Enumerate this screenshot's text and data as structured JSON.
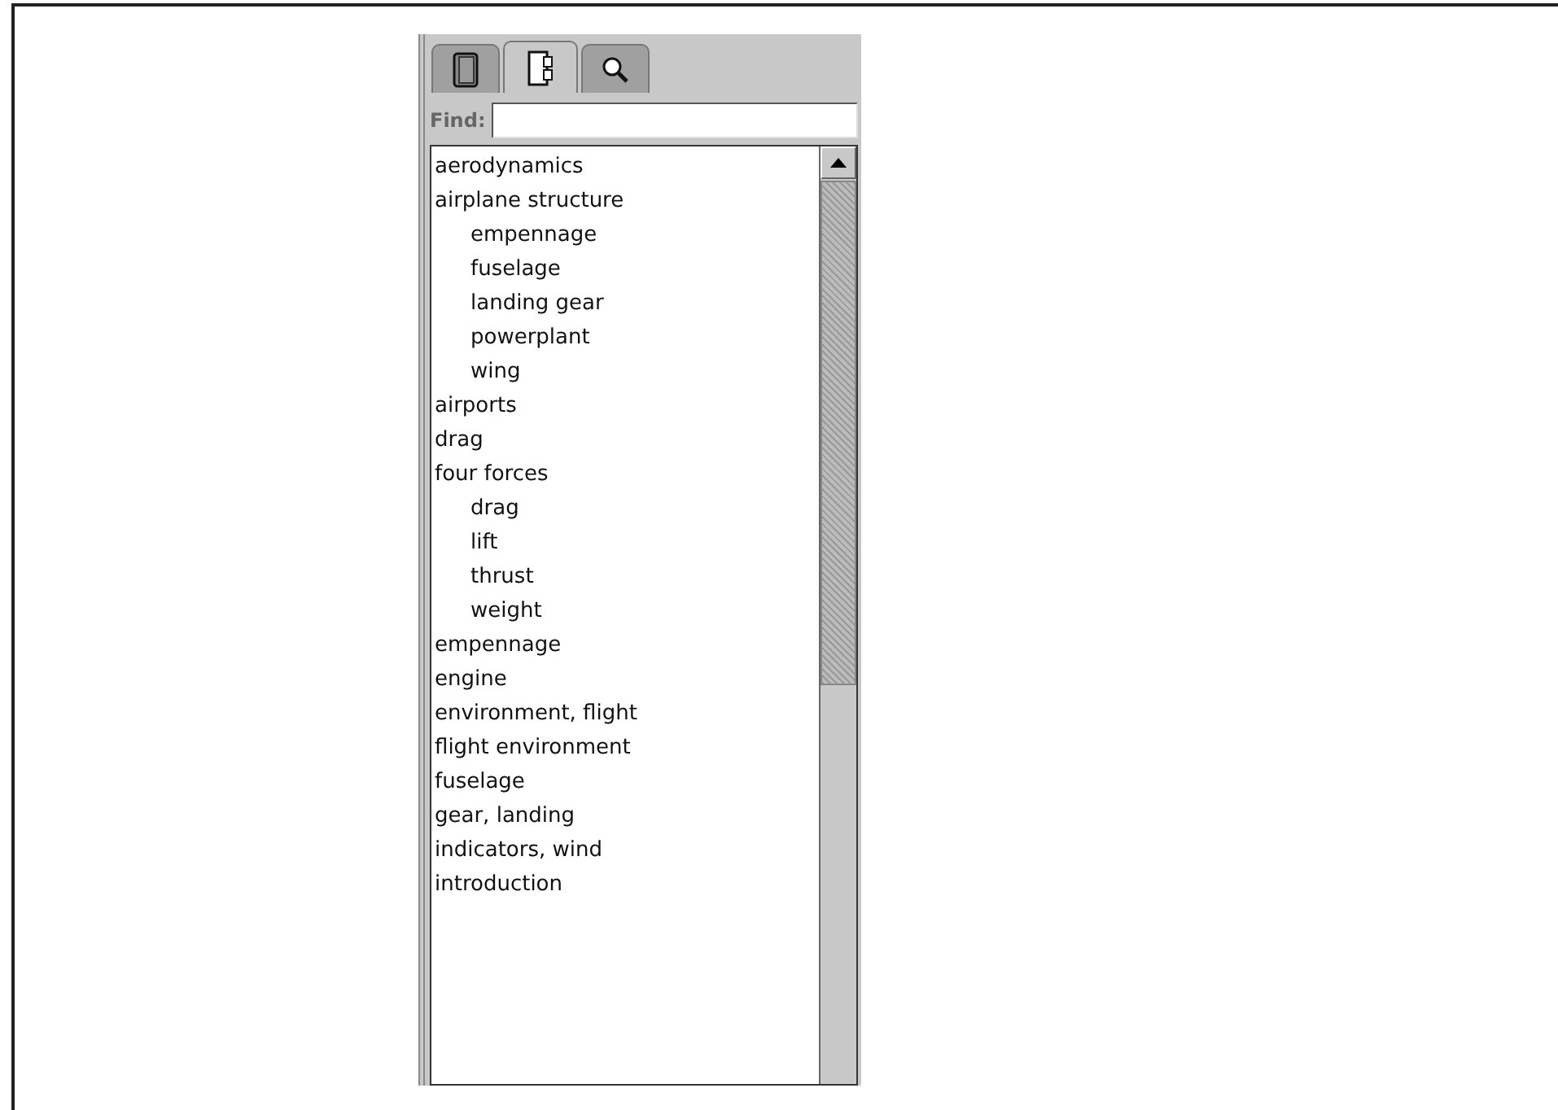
{
  "tabs": [
    {
      "kind": "book",
      "selected": false
    },
    {
      "kind": "notebook",
      "selected": true
    },
    {
      "kind": "search",
      "selected": false
    }
  ],
  "find": {
    "label": "Find:"
  },
  "index": [
    {
      "label": "aerodynamics"
    },
    {
      "label": "airplane structure",
      "children": [
        {
          "label": "empennage"
        },
        {
          "label": "fuselage"
        },
        {
          "label": "landing gear"
        },
        {
          "label": "powerplant"
        },
        {
          "label": "wing"
        }
      ]
    },
    {
      "label": "airports"
    },
    {
      "label": "drag"
    },
    {
      "label": "four forces",
      "children": [
        {
          "label": "drag"
        },
        {
          "label": "lift"
        },
        {
          "label": "thrust"
        },
        {
          "label": "weight"
        }
      ]
    },
    {
      "label": "empennage"
    },
    {
      "label": "engine"
    },
    {
      "label": "environment, flight"
    },
    {
      "label": "flight environment"
    },
    {
      "label": "fuselage"
    },
    {
      "label": "gear, landing"
    },
    {
      "label": "indicators, wind"
    },
    {
      "label": "introduction"
    }
  ]
}
